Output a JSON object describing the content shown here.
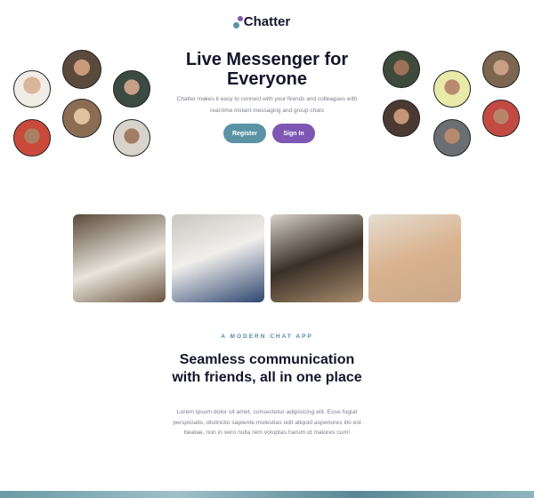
{
  "brand": {
    "name": "Chatter",
    "colors": {
      "teal": "#5b93a5",
      "purple": "#7d57b3",
      "dark": "#14152b"
    }
  },
  "hero": {
    "title": "Live Messenger for Everyone",
    "subtitle": "Chatter makes it easy to connect with your firends and colleagues with real-time instant messaging and group chats",
    "register_label": "Register",
    "signin_label": "Sign In"
  },
  "section": {
    "eyebrow": "A MODERN CHAT APP",
    "title": "Seamless communication with friends, all in one place",
    "body": "Lorem ipsum dolor sit amet, consectetur adipisicing elit. Esse fugiat perspiciatis, distinctio sapiente molestias odit aliquid asperiores illo est beatae, non in vero nulla rem voluptas harum id maiores cum!"
  }
}
